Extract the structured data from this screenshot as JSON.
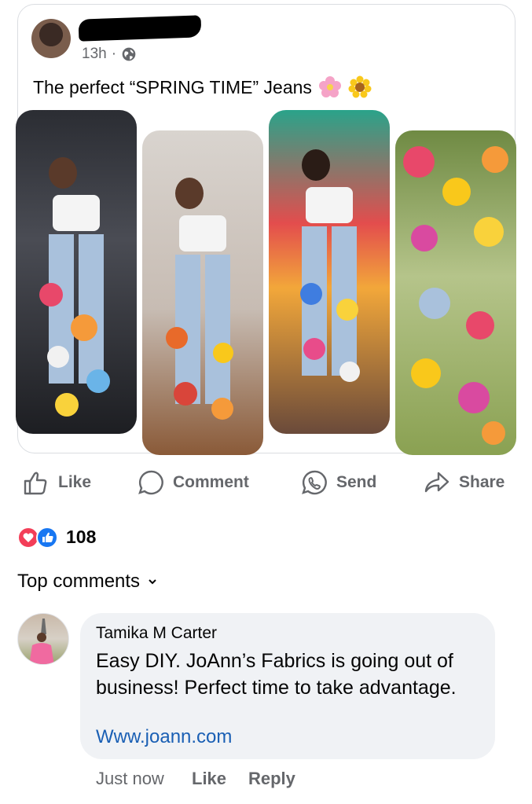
{
  "post": {
    "time": "13h",
    "separator": "·",
    "caption": "The perfect “SPRING TIME” Jeans"
  },
  "actions": {
    "like": "Like",
    "comment": "Comment",
    "send": "Send",
    "share": "Share"
  },
  "reactions": {
    "count": "108"
  },
  "top_comments": {
    "label": "Top comments"
  },
  "comment": {
    "author": "Tamika M Carter",
    "text": "Easy DIY. JoAnn’s Fabrics is going out of business! Perfect time to take advantage.",
    "link": "Www.joann.com",
    "time": "Just now",
    "like": "Like",
    "reply": "Reply"
  },
  "colors": {
    "muted": "#65676b",
    "link": "#1a5fb4",
    "love": "#f33e58",
    "like": "#1877f2",
    "bubble": "#f0f2f5"
  },
  "icons": [
    "globe-icon",
    "pink-flower-emoji",
    "sunflower-emoji",
    "like-icon",
    "comment-icon",
    "send-icon",
    "share-icon",
    "love-reaction-icon",
    "like-reaction-icon",
    "chevron-down-icon"
  ]
}
